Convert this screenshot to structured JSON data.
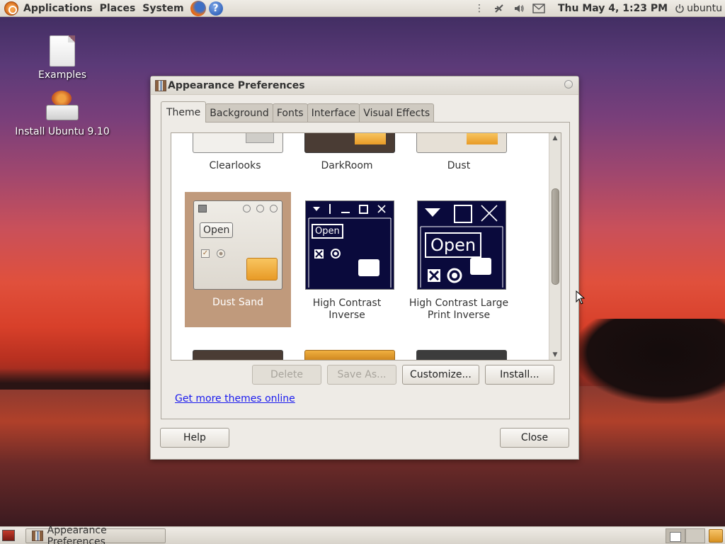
{
  "top_panel": {
    "menus": [
      "Applications",
      "Places",
      "System"
    ],
    "clock": "Thu May  4,  1:23 PM",
    "user": "ubuntu"
  },
  "desktop_icons": {
    "examples": "Examples",
    "install": "Install Ubuntu 9.10"
  },
  "dialog": {
    "title": "Appearance Preferences",
    "tabs": [
      "Theme",
      "Background",
      "Fonts",
      "Interface",
      "Visual Effects"
    ],
    "active_tab": "Theme",
    "themes_top_row": [
      "Clearlooks",
      "DarkRoom",
      "Dust"
    ],
    "themes_mid_row": [
      {
        "name": "Dust Sand",
        "selected": true
      },
      {
        "name": "High Contrast Inverse",
        "selected": false
      },
      {
        "name": "High Contrast Large Print Inverse",
        "selected": false
      }
    ],
    "preview_open": "Open",
    "buttons": {
      "delete": "Delete",
      "save_as": "Save As...",
      "customize": "Customize...",
      "install": "Install..."
    },
    "link": "Get more themes online",
    "help": "Help",
    "close": "Close"
  },
  "taskbar": {
    "window_button": "Appearance Preferences"
  },
  "colors": {
    "selection": "#c09a7c",
    "hc_background": "#0a0a3c",
    "link": "#1a1aee"
  }
}
